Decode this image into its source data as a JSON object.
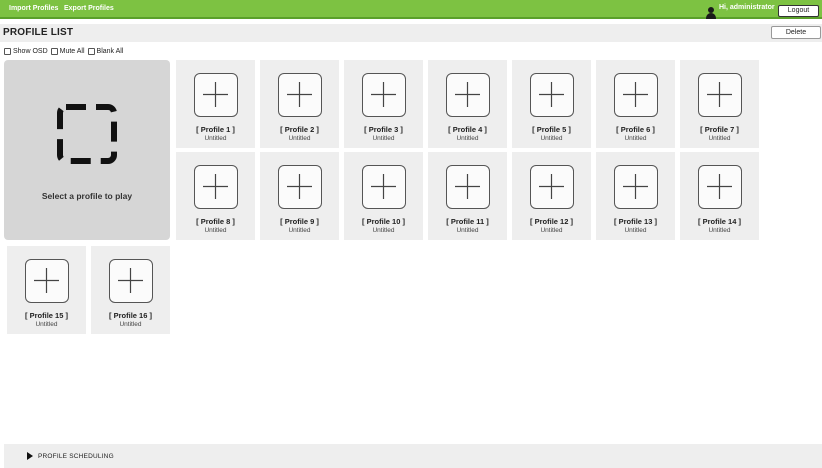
{
  "topbar": {
    "import_label": "Import Profiles",
    "export_label": "Export Profiles",
    "greeting": "Hi, administrator",
    "logout_label": "Logout"
  },
  "header": {
    "title": "PROFILE LIST",
    "delete_label": "Delete"
  },
  "options": {
    "show_osd": "Show OSD",
    "mute_all": "Mute All",
    "blank_all": "Blank All"
  },
  "player": {
    "label": "Select a profile to play"
  },
  "profiles": [
    {
      "name": "[ Profile 1 ]",
      "status": "Untitled"
    },
    {
      "name": "[ Profile 2 ]",
      "status": "Untitled"
    },
    {
      "name": "[ Profile 3 ]",
      "status": "Untitled"
    },
    {
      "name": "[ Profile 4 ]",
      "status": "Untitled"
    },
    {
      "name": "[ Profile 5 ]",
      "status": "Untitled"
    },
    {
      "name": "[ Profile 6 ]",
      "status": "Untitled"
    },
    {
      "name": "[ Profile 7 ]",
      "status": "Untitled"
    },
    {
      "name": "[ Profile 8 ]",
      "status": "Untitled"
    },
    {
      "name": "[ Profile 9 ]",
      "status": "Untitled"
    },
    {
      "name": "[ Profile 10 ]",
      "status": "Untitled"
    },
    {
      "name": "[ Profile 11 ]",
      "status": "Untitled"
    },
    {
      "name": "[ Profile 12 ]",
      "status": "Untitled"
    },
    {
      "name": "[ Profile 13 ]",
      "status": "Untitled"
    },
    {
      "name": "[ Profile 14 ]",
      "status": "Untitled"
    },
    {
      "name": "[ Profile 15 ]",
      "status": "Untitled"
    },
    {
      "name": "[ Profile 16 ]",
      "status": "Untitled"
    }
  ],
  "scheduling": {
    "label": "PROFILE SCHEDULING"
  },
  "colors": {
    "topbar": "#7dc242",
    "tile_bg": "#eeeeee",
    "player_bg": "#d6d6d6"
  },
  "icons": {
    "tile": "plus-icon",
    "player": "dashed-frame-icon",
    "user": "user-icon",
    "expand": "triangle-right-icon"
  }
}
